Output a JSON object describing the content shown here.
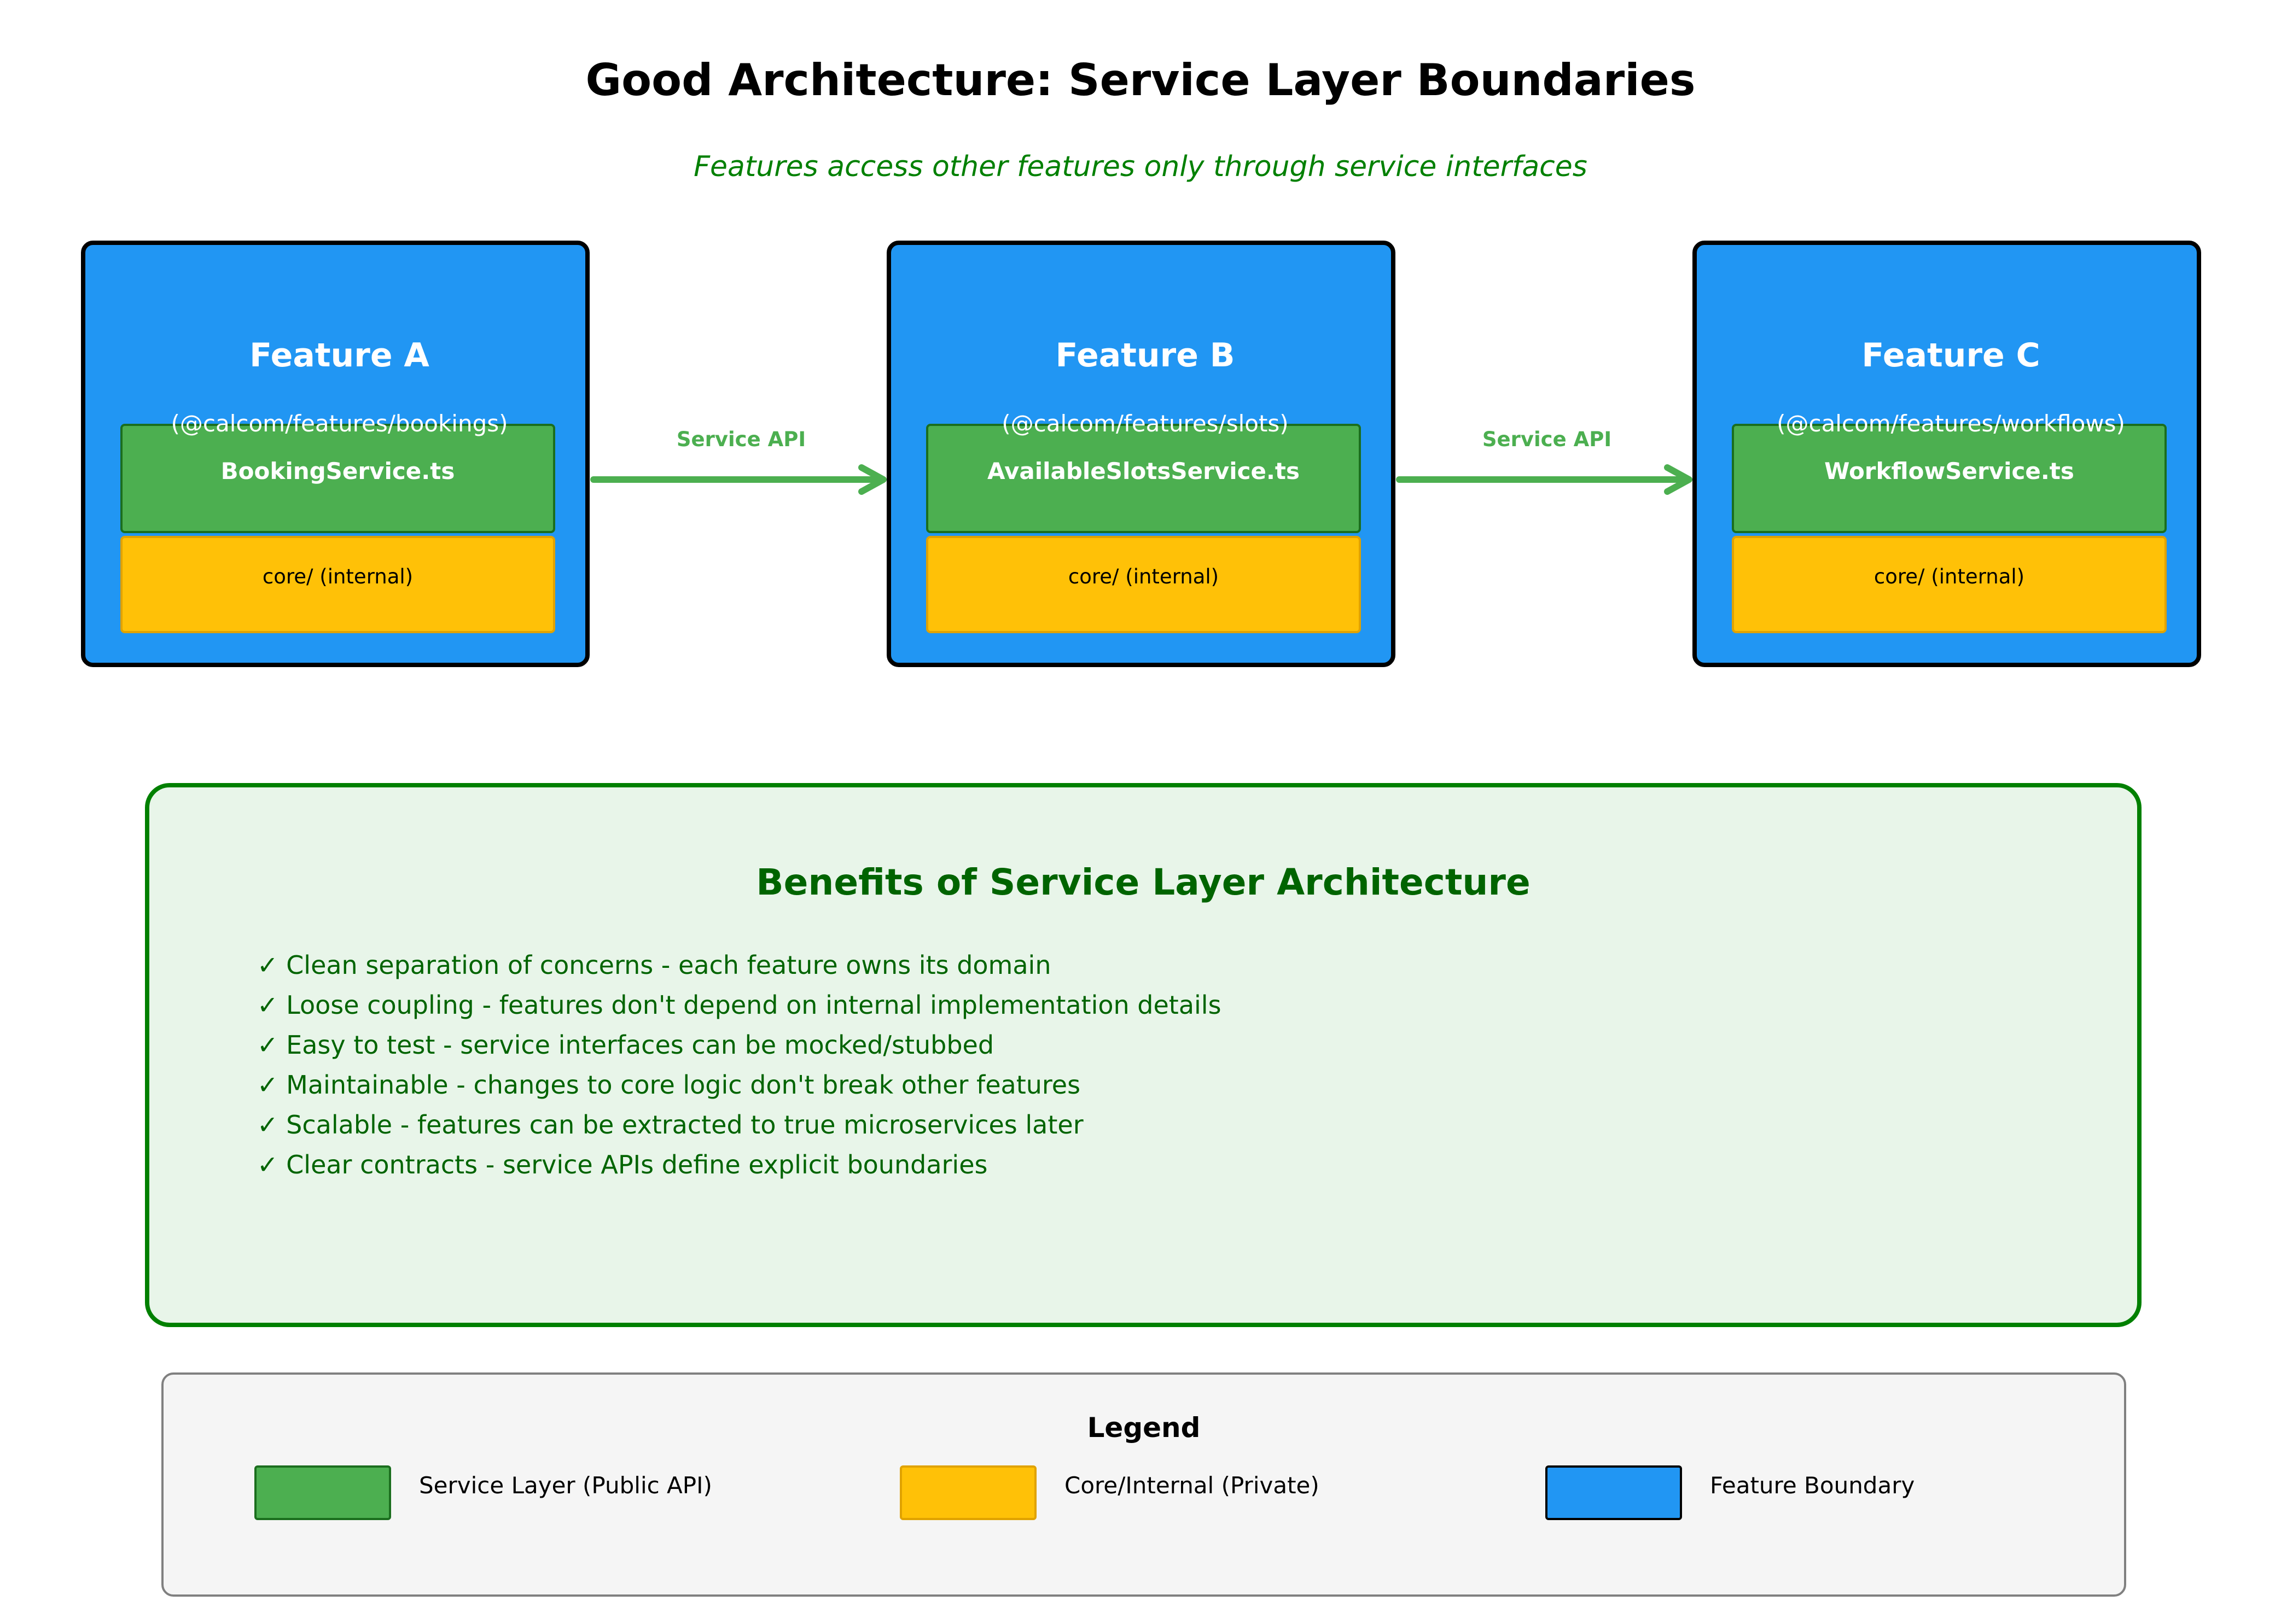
{
  "title": "Good Architecture: Service Layer Boundaries",
  "subtitle": "Features access other features only through service interfaces",
  "colors": {
    "feature_boundary": "#2196F3",
    "service_layer": "#4CAF50",
    "core_internal": "#FFC107",
    "arrow": "#4CAF50",
    "benefits_bg": "#E8F5E9",
    "benefits_border": "#008000",
    "benefits_text": "#006400",
    "legend_bg": "#F5F5F5"
  },
  "features": [
    {
      "name": "Feature A",
      "package": "(@calcom/features/bookings)",
      "service": "BookingService.ts",
      "core": "core/ (internal)"
    },
    {
      "name": "Feature B",
      "package": "(@calcom/features/slots)",
      "service": "AvailableSlotsService.ts",
      "core": "core/ (internal)"
    },
    {
      "name": "Feature C",
      "package": "(@calcom/features/workflows)",
      "service": "WorkflowService.ts",
      "core": "core/ (internal)"
    }
  ],
  "arrows": [
    {
      "label": "Service API"
    },
    {
      "label": "Service API"
    }
  ],
  "benefits": {
    "title": "Benefits of Service Layer Architecture",
    "items": [
      "✓ Clean separation of concerns - each feature owns its domain",
      "✓ Loose coupling - features don't depend on internal implementation details",
      "✓ Easy to test - service interfaces can be mocked/stubbed",
      "✓ Maintainable - changes to core logic don't break other features",
      "✓ Scalable - features can be extracted to true microservices later",
      "✓ Clear contracts - service APIs define explicit boundaries"
    ]
  },
  "legend": {
    "title": "Legend",
    "items": [
      {
        "label": "Service Layer (Public API)",
        "color": "#4CAF50",
        "border": "#1b6e1e"
      },
      {
        "label": "Core/Internal (Private)",
        "color": "#FFC107",
        "border": "#e0a200"
      },
      {
        "label": "Feature Boundary",
        "color": "#2196F3",
        "border": "#000000"
      }
    ]
  }
}
